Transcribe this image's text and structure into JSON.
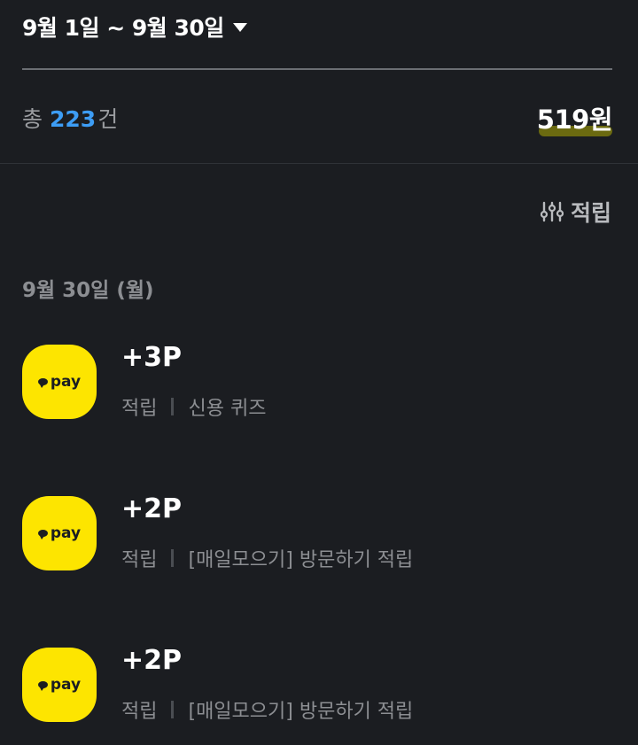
{
  "header": {
    "date_range": "9월 1일 ~ 9월 30일"
  },
  "summary": {
    "count_prefix": "총",
    "count": "223",
    "count_suffix": "건",
    "total": "519원"
  },
  "filter": {
    "label": "적립",
    "icon": "sliders-icon"
  },
  "groups": [
    {
      "date": "9월 30일 (월)",
      "items": [
        {
          "logo_text": "pay",
          "amount": "+3P",
          "type": "적립",
          "description": "신용 퀴즈"
        },
        {
          "logo_text": "pay",
          "amount": "+2P",
          "type": "적립",
          "description": "[매일모으기] 방문하기 적립"
        },
        {
          "logo_text": "pay",
          "amount": "+2P",
          "type": "적립",
          "description": "[매일모으기] 방문하기 적립"
        }
      ]
    }
  ],
  "colors": {
    "background": "#1b1d21",
    "accent_blue": "#3d9df5",
    "logo_yellow": "#fde500",
    "total_highlight": "#6b6a10"
  }
}
